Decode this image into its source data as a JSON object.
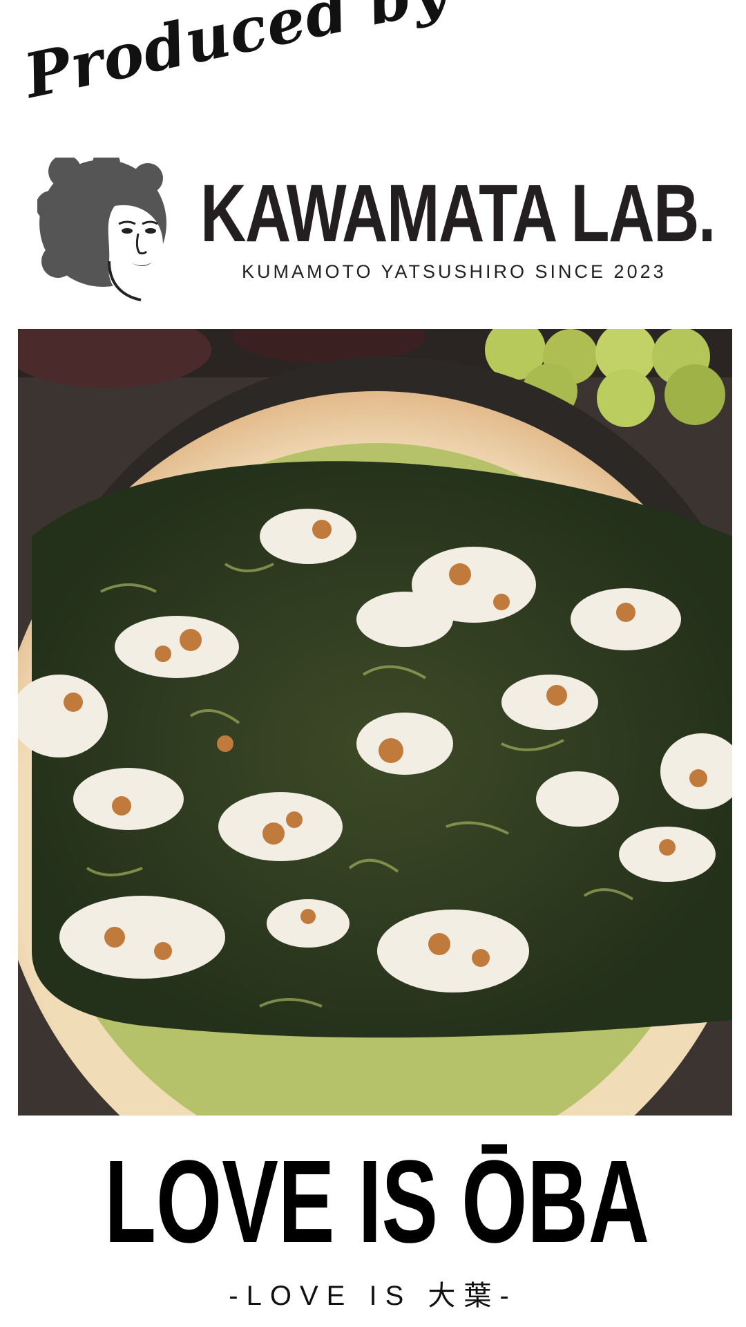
{
  "header": {
    "produced_by": "Produced by",
    "brand_name": "KAWAMATA LAB.",
    "tagline": "KUMAMOTO YATSUSHIRO SINCE 2023",
    "logo_icon": "woman-afro-portrait-logo"
  },
  "photo": {
    "subject": "pizza-photo",
    "colors": {
      "crust": "#e8c79a",
      "sauce": "#2f3a1f",
      "cheese": "#f4efe6",
      "grape": "#b7c95a"
    }
  },
  "footer": {
    "headline": "LOVE IS ŌBA",
    "subline": "-LOVE IS 大葉-"
  }
}
